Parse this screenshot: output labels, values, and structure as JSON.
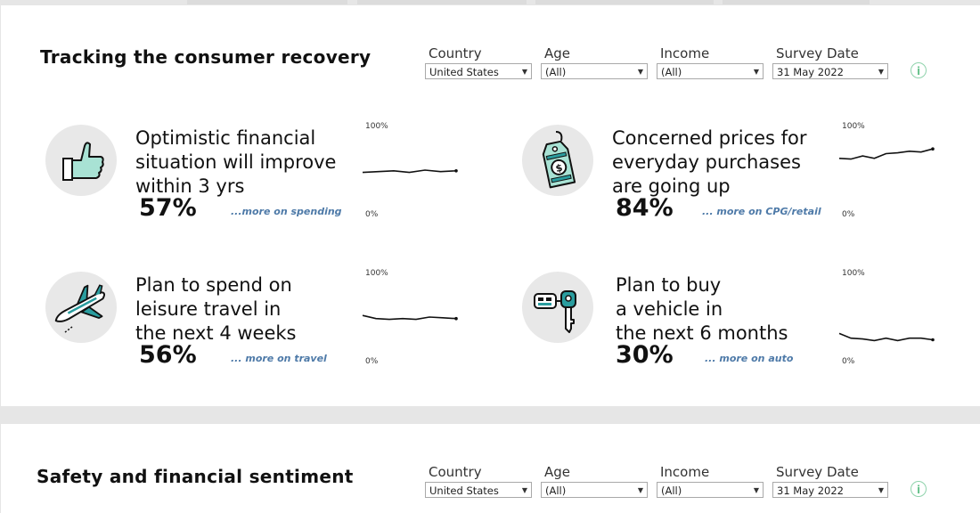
{
  "section1": {
    "title": "Tracking the consumer recovery",
    "filters": [
      {
        "label": "Country",
        "value": "United States"
      },
      {
        "label": "Age",
        "value": "(All)"
      },
      {
        "label": "Income",
        "value": "(All)"
      },
      {
        "label": "Survey Date",
        "value": "31 May 2022"
      }
    ],
    "info_icon": "info-icon",
    "metrics": [
      {
        "icon": "thumbs-up-icon",
        "lines": [
          "Optimistic financial",
          "situation will improve",
          "within 3 yrs"
        ],
        "value": "57%",
        "link": "...more on spending",
        "axis_top": "100%",
        "axis_bottom": "0%",
        "trend": [
          0.55,
          0.56,
          0.57,
          0.55,
          0.58,
          0.56,
          0.57
        ]
      },
      {
        "icon": "price-tag-icon",
        "lines": [
          "Concerned prices for",
          "everyday purchases",
          "are going up"
        ],
        "value": "84%",
        "link": "... more on CPG/retail",
        "axis_top": "100%",
        "axis_bottom": "0%",
        "trend": [
          0.73,
          0.72,
          0.76,
          0.73,
          0.79,
          0.8,
          0.82,
          0.81,
          0.85
        ]
      },
      {
        "icon": "airplane-icon",
        "lines": [
          "Plan to spend on",
          "leisure travel in",
          "the next 4 weeks"
        ],
        "value": "56%",
        "link": "... more on travel",
        "axis_top": "100%",
        "axis_bottom": "0%",
        "trend": [
          0.6,
          0.56,
          0.55,
          0.56,
          0.55,
          0.58,
          0.57,
          0.56
        ]
      },
      {
        "icon": "car-key-icon",
        "lines": [
          "Plan to buy",
          "a vehicle in",
          "the next 6 months"
        ],
        "value": "30%",
        "link": "... more on auto",
        "axis_top": "100%",
        "axis_bottom": "0%",
        "trend": [
          0.37,
          0.31,
          0.3,
          0.28,
          0.31,
          0.28,
          0.31,
          0.31,
          0.29
        ]
      }
    ]
  },
  "section2": {
    "title": "Safety and financial sentiment",
    "filters": [
      {
        "label": "Country",
        "value": "United States"
      },
      {
        "label": "Age",
        "value": "(All)"
      },
      {
        "label": "Income",
        "value": "(All)"
      },
      {
        "label": "Survey Date",
        "value": "31 May 2022"
      }
    ],
    "info_icon": "info-icon"
  },
  "colors": {
    "teal": "#2a9d9f",
    "link": "#4e7aa8",
    "icon_bg": "#e8e8e8",
    "info": "#6cc48f"
  }
}
